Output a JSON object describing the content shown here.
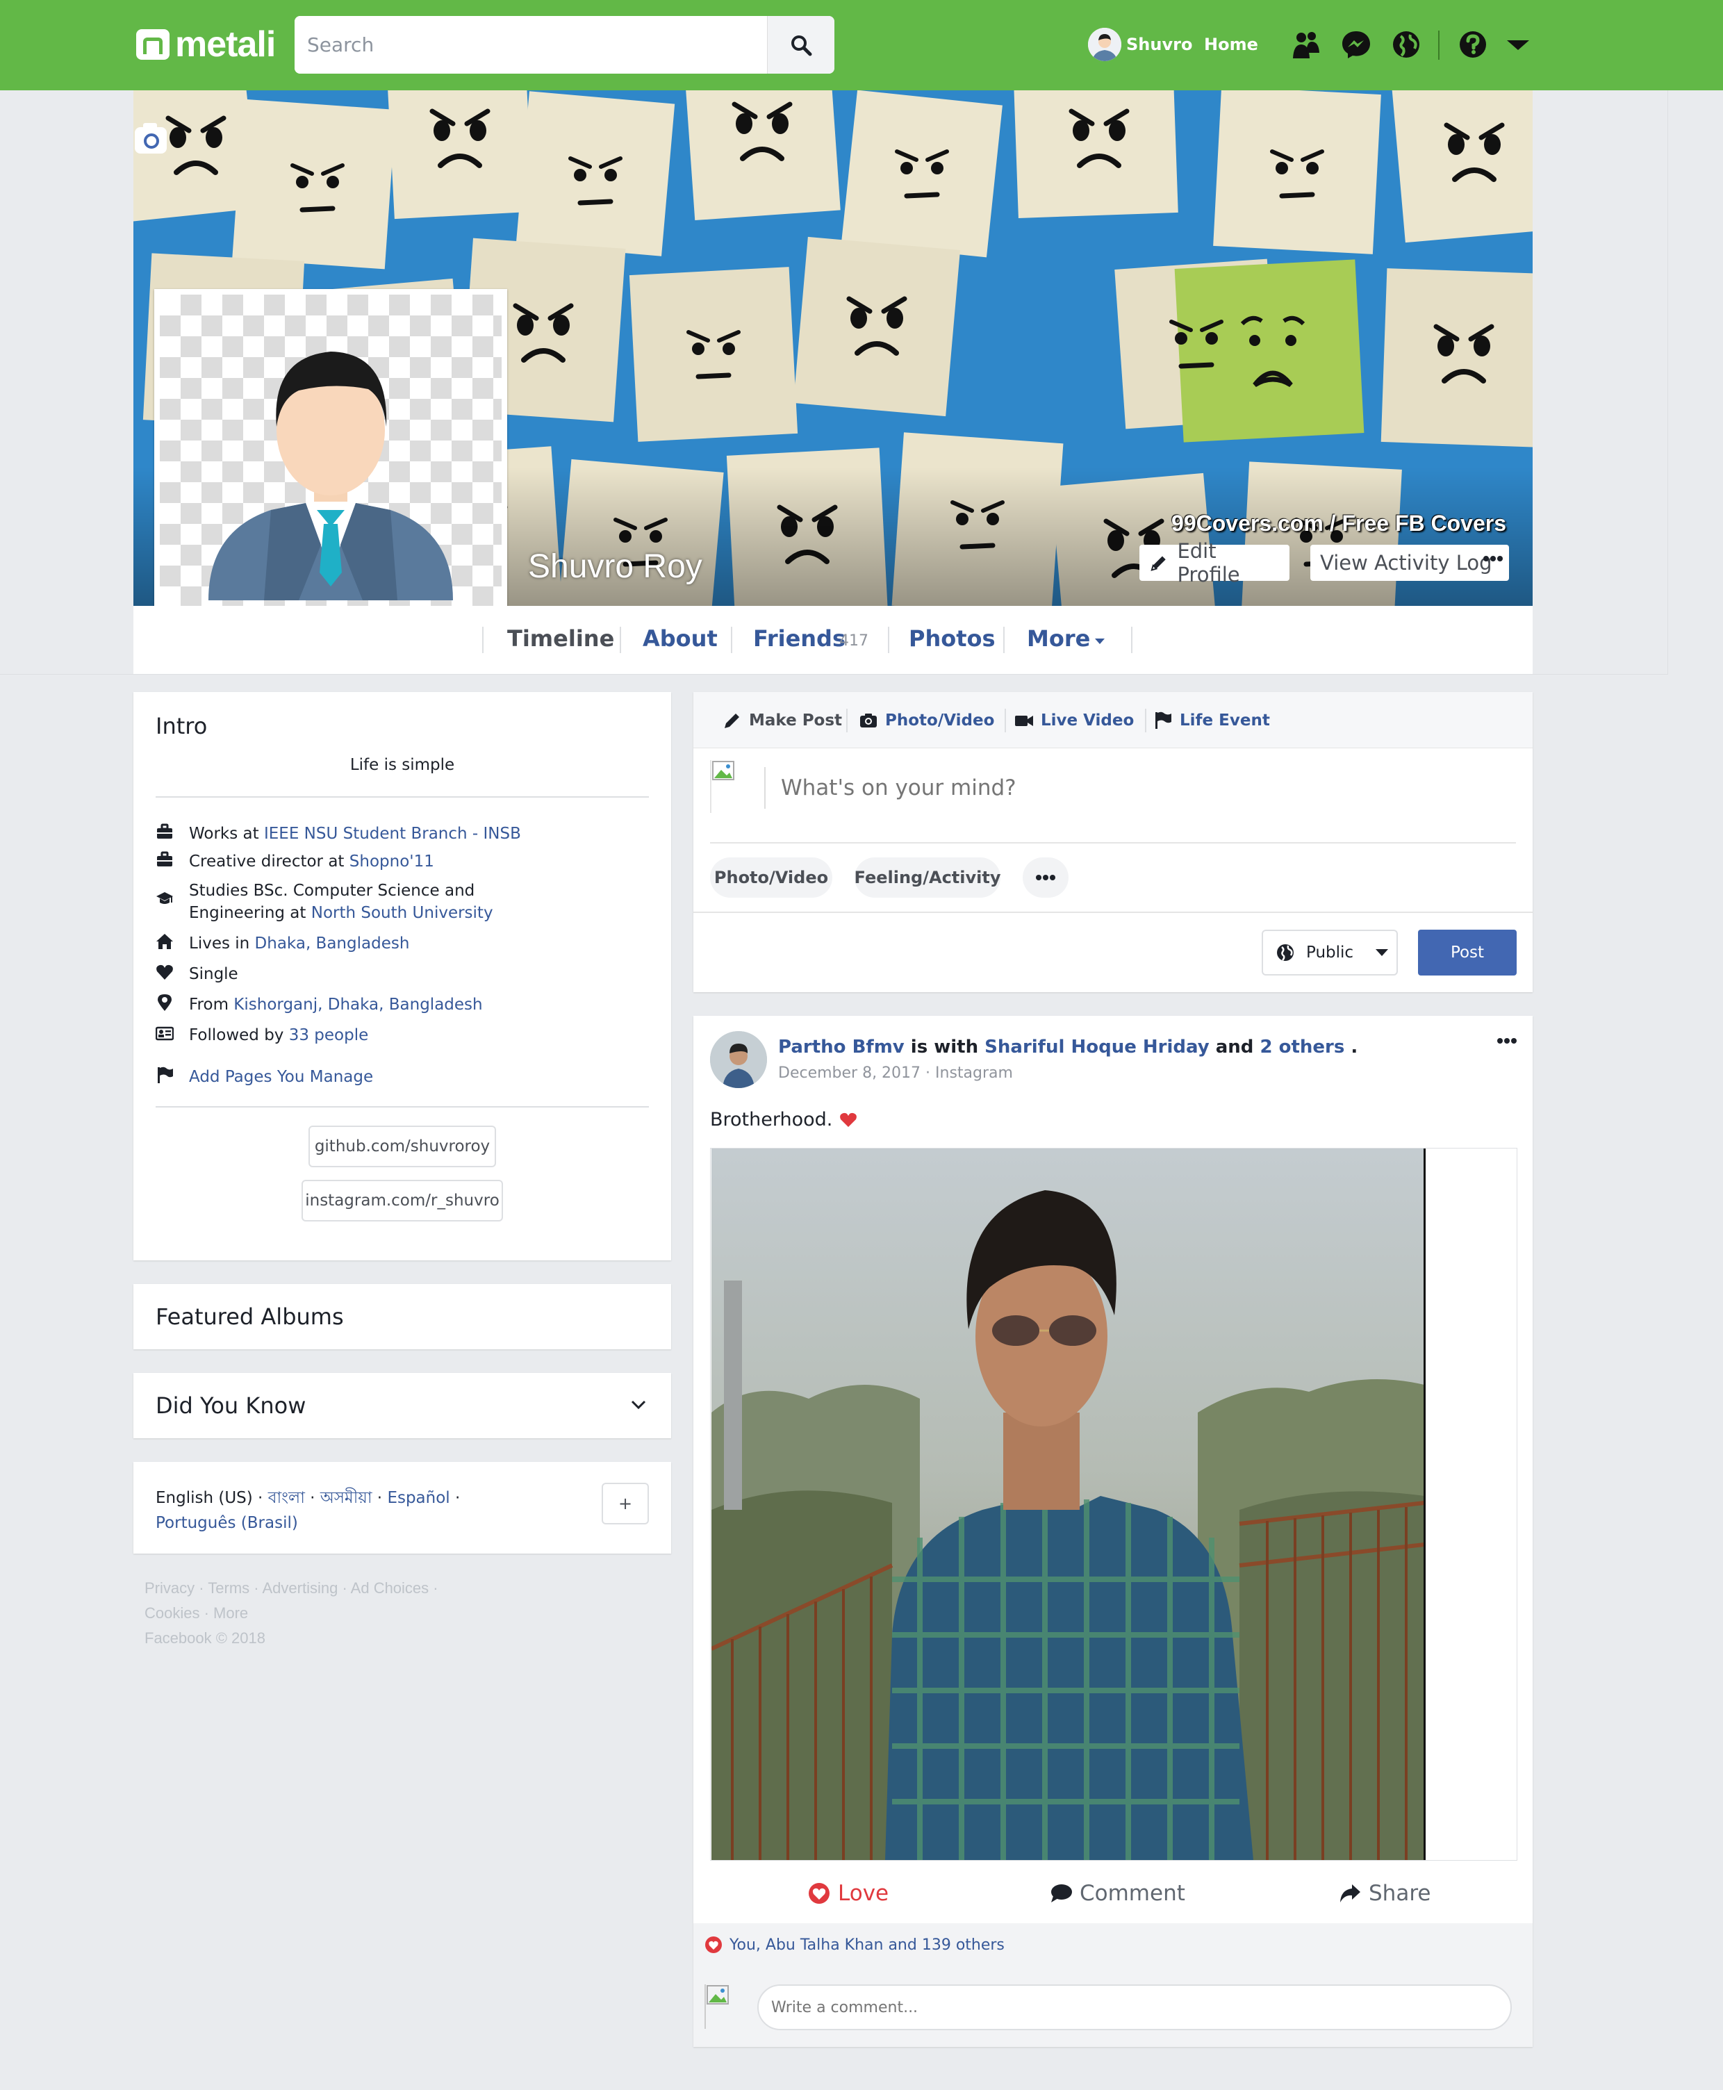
{
  "app": {
    "logo_text": "metali",
    "search_placeholder": "Search",
    "user_name": "Shuvro",
    "home_label": "Home",
    "brand_color": "#62b847",
    "link_color": "#365899"
  },
  "cover": {
    "credit": "99Covers.com / Free FB Covers",
    "profile_name": "Shuvro Roy",
    "edit_profile": "Edit Profile",
    "activity_log": "View Activity Log"
  },
  "tabs": {
    "timeline": "Timeline",
    "about": "About",
    "friends": "Friends",
    "friends_count": "417",
    "photos": "Photos",
    "more": "More"
  },
  "intro": {
    "title": "Intro",
    "bio": "Life is simple",
    "rows": [
      {
        "prefix": "Works at ",
        "link": "IEEE NSU Student Branch - INSB",
        "icon": "briefcase-icon"
      },
      {
        "prefix": "Creative director at ",
        "link": "Shopno'11",
        "icon": "briefcase-icon"
      },
      {
        "prefix": "Studies BSc. Computer Science and",
        "line2_prefix": "Engineering at ",
        "link": "North South University",
        "icon": "graduation-cap-icon"
      },
      {
        "prefix": "Lives in ",
        "link": "Dhaka, Bangladesh",
        "icon": "home-icon"
      },
      {
        "prefix": "Single",
        "link": "",
        "icon": "heart-icon"
      },
      {
        "prefix": "From ",
        "link": "Kishorganj, Dhaka, Bangladesh",
        "icon": "map-pin-icon"
      },
      {
        "prefix": "Followed by ",
        "link": "33 people",
        "icon": "followers-icon"
      }
    ],
    "add_pages": "Add Pages You Manage",
    "links": [
      "github.com/shuvroroy",
      "instagram.com/r_shuvro"
    ]
  },
  "featured_albums": {
    "title": "Featured Albums"
  },
  "did_you_know": {
    "title": "Did You Know"
  },
  "languages": {
    "current": "English (US) · ",
    "links": [
      "বাংলা",
      "অসমীয়া",
      "Español",
      "Português (Brasil)"
    ],
    "sep": " · ",
    "add_label": "+"
  },
  "footer": {
    "line1": "Privacy · Terms · Advertising · Ad Choices ·",
    "line2": "Cookies · More",
    "line3": "Facebook © 2018"
  },
  "composer": {
    "tabs": [
      "Make Post",
      "Photo/Video",
      "Live Video",
      "Life Event"
    ],
    "placeholder": "What's on your mind?",
    "chips": [
      "Photo/Video",
      "Feeling/Activity"
    ],
    "audience": "Public",
    "post_button": "Post"
  },
  "post": {
    "author": "Partho Bfmv",
    "with_text": " is with ",
    "tagged": "Shariful Hoque Hriday",
    "and_text": " and ",
    "others": "2 others",
    "end": " .",
    "date": "December 8, 2017 · Instagram",
    "text": "Brotherhood.",
    "actions": [
      "Love",
      "Comment",
      "Share"
    ],
    "reactions": "You, Abu Talha Khan and 139 others",
    "comment_placeholder": "Write a comment..."
  }
}
